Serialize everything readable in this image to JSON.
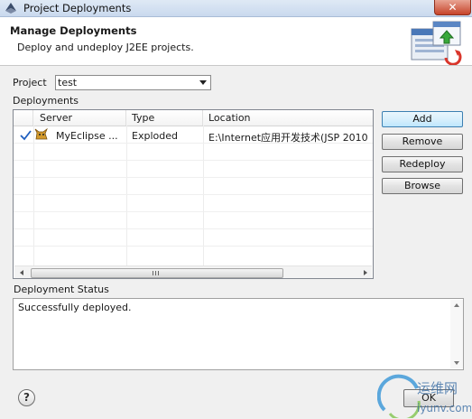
{
  "window": {
    "title": "Project Deployments",
    "close_label": "✕"
  },
  "banner": {
    "title": "Manage Deployments",
    "description": "Deploy and undeploy J2EE projects."
  },
  "project": {
    "label": "Project",
    "selected": "test"
  },
  "deployments": {
    "label": "Deployments",
    "columns": [
      "Server",
      "Type",
      "Location"
    ],
    "rows": [
      {
        "status_icon": "check-icon",
        "server_icon": "tomcat-icon",
        "server": "MyEclipse ...",
        "type": "Exploded",
        "location": "E:\\Internet应用开发技术(JSP 2010"
      }
    ],
    "scroll_grip": "III"
  },
  "buttons": {
    "add": "Add",
    "remove": "Remove",
    "redeploy": "Redeploy",
    "browse": "Browse",
    "ok": "OK"
  },
  "status": {
    "label": "Deployment Status",
    "text": "Successfully deployed."
  },
  "help": {
    "icon": "help-icon",
    "glyph": "?"
  },
  "watermark": {
    "line1": "运维网",
    "line2": "iyunv.com"
  },
  "colors": {
    "accent": "#3c7fb1",
    "check": "#1f5fbf",
    "close": "#c7442a"
  }
}
